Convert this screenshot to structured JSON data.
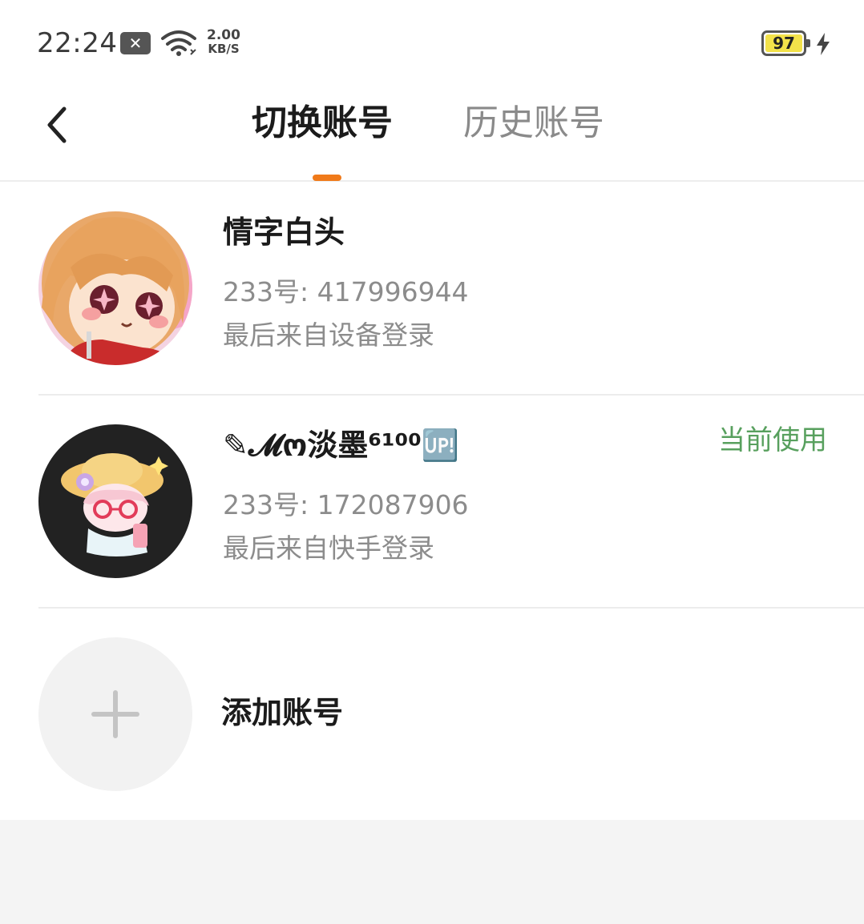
{
  "status_bar": {
    "time": "22:24",
    "notification_icon": "close-box-icon",
    "wifi_icon": "wifi-icon",
    "net_speed_value": "2.00",
    "net_speed_unit": "KB/S",
    "battery_level": "97",
    "charging_icon": "bolt-icon"
  },
  "nav": {
    "back_icon": "chevron-left-icon",
    "tabs": [
      {
        "label": "切换账号",
        "active": true
      },
      {
        "label": "历史账号",
        "active": false
      }
    ],
    "accent_color": "#f07a1a"
  },
  "accounts": [
    {
      "name": "情字白头",
      "id_text": "233号: 417996944",
      "login_text": "最后来自设备登录",
      "current": false,
      "avatar": "anime-girl-avatar"
    },
    {
      "name": "✎𝓜ო淡墨⁶¹⁰⁰🆙",
      "id_text": "233号: 172087906",
      "login_text": "最后来自快手登录",
      "current": true,
      "current_label": "当前使用",
      "avatar": "chibi-sunhat-avatar"
    }
  ],
  "add_account": {
    "label": "添加账号",
    "icon": "plus-icon"
  },
  "colors": {
    "current_badge": "#58a05e",
    "background": "#f4f4f4"
  }
}
